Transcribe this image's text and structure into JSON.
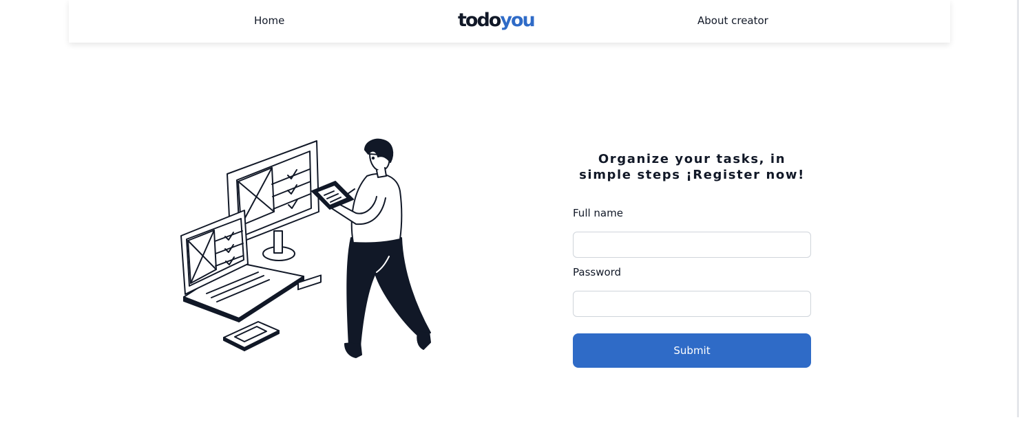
{
  "nav": {
    "home_label": "Home",
    "about_label": "About creator",
    "logo_part1": "todo",
    "logo_part2": "you"
  },
  "form": {
    "title": "Organize your tasks, in simple steps ¡Register now!",
    "fullname_label": "Full name",
    "fullname_value": "",
    "password_label": "Password",
    "password_value": "",
    "submit_label": "Submit"
  },
  "colors": {
    "accent": "#2f6bc7",
    "text": "#111827",
    "background": "#ffffff"
  },
  "illustration": {
    "icon": "person-with-tablet-and-computers-illustration"
  }
}
